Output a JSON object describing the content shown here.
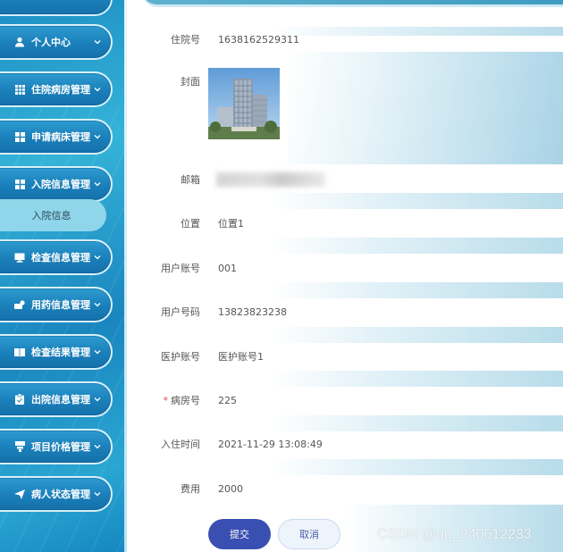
{
  "sidebar": {
    "items": [
      {
        "label": "",
        "icon": "menu-icon"
      },
      {
        "label": "个人中心",
        "icon": "user-icon"
      },
      {
        "label": "住院病房管理",
        "icon": "grid-icon"
      },
      {
        "label": "申请病床管理",
        "icon": "grid-icon"
      },
      {
        "label": "入院信息管理",
        "icon": "grid-icon"
      },
      {
        "label": "检查信息管理",
        "icon": "monitor-icon"
      },
      {
        "label": "用药信息管理",
        "icon": "pill-icon"
      },
      {
        "label": "检查结果管理",
        "icon": "book-icon"
      },
      {
        "label": "出院信息管理",
        "icon": "clipboard-icon"
      },
      {
        "label": "项目价格管理",
        "icon": "tag-icon"
      },
      {
        "label": "病人状态管理",
        "icon": "send-icon"
      }
    ],
    "active_subitem": "入院信息"
  },
  "form": {
    "admission_no": {
      "label": "住院号",
      "value": "1638162529311"
    },
    "cover": {
      "label": "封面"
    },
    "email": {
      "label": "邮箱",
      "value": ""
    },
    "location": {
      "label": "位置",
      "value": "位置1"
    },
    "user_account": {
      "label": "用户账号",
      "value": "001"
    },
    "user_phone": {
      "label": "用户号码",
      "value": "13823823238"
    },
    "nurse_account": {
      "label": "医护账号",
      "value": "医护账号1"
    },
    "ward_no": {
      "label": "病房号",
      "value": "225",
      "required_mark": "*"
    },
    "checkin_time": {
      "label": "入住时间",
      "value": "2021-11-29 13:08:49"
    },
    "cost": {
      "label": "费用",
      "value": "2000"
    }
  },
  "buttons": {
    "submit": "提交",
    "cancel": "取消"
  },
  "watermark": "CSDN @qq_840612233",
  "colors": {
    "sidebar": "#1c8fc4",
    "accent": "#3a4fb2",
    "active_sub": "#8fd6ea"
  }
}
